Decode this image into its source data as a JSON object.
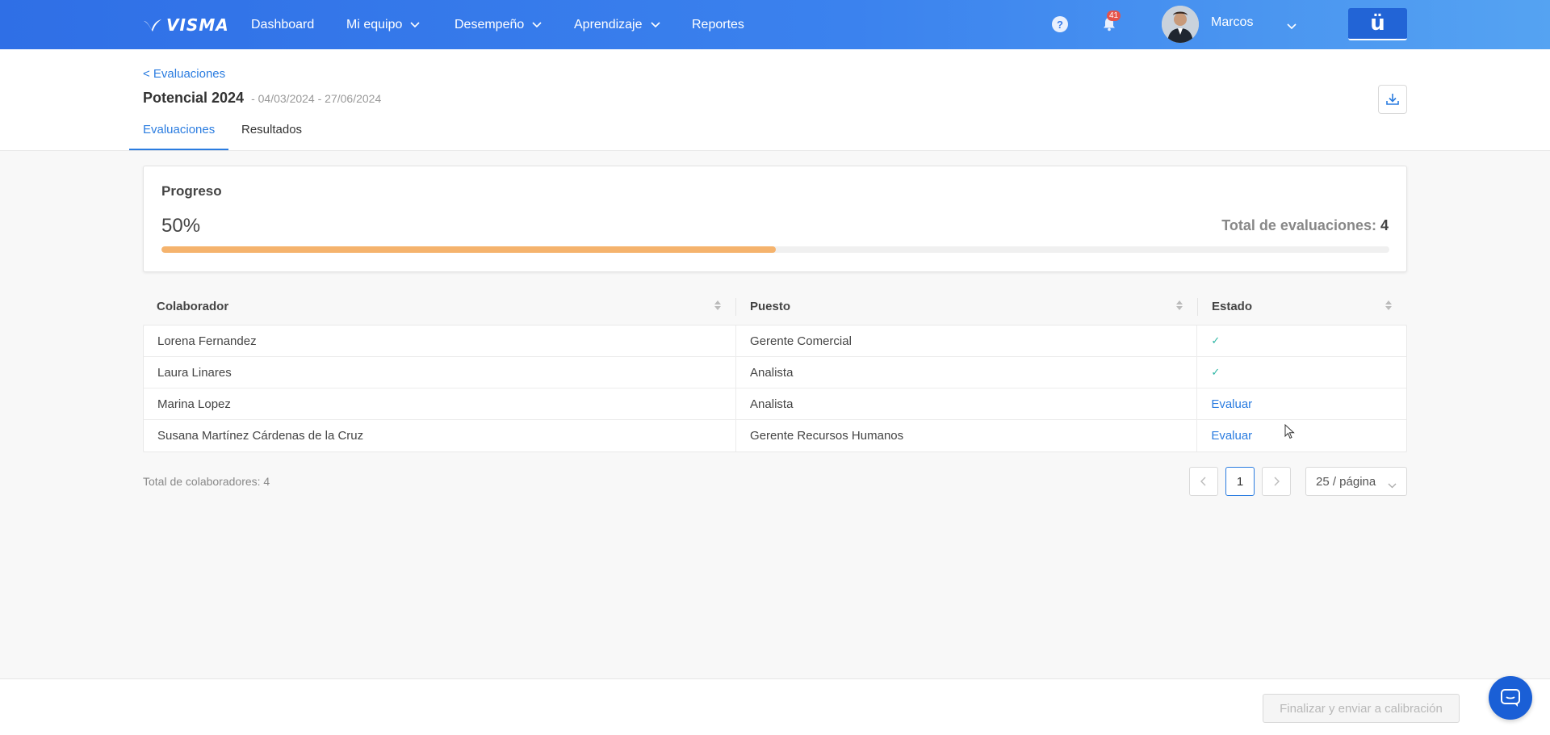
{
  "nav": {
    "brand": "VISMA",
    "items": [
      {
        "label": "Dashboard",
        "has_dropdown": false
      },
      {
        "label": "Mi equipo",
        "has_dropdown": true
      },
      {
        "label": "Desempeño",
        "has_dropdown": true
      },
      {
        "label": "Aprendizaje",
        "has_dropdown": true
      },
      {
        "label": "Reportes",
        "has_dropdown": false
      }
    ],
    "help_icon": "question-circle-icon",
    "notifications_count": "41",
    "user_name": "Marcos",
    "app_button_label": "ü"
  },
  "header": {
    "back_link": "< Evaluaciones",
    "title": "Potencial 2024",
    "dates": "- 04/03/2024 - 27/06/2024",
    "tabs": [
      {
        "label": "Evaluaciones",
        "active": true
      },
      {
        "label": "Resultados",
        "active": false
      }
    ]
  },
  "progress": {
    "title": "Progreso",
    "percent_label": "50%",
    "percent_value": 50,
    "total_label": "Total de evaluaciones:",
    "total_value": "4",
    "bar_color": "#f5b36d"
  },
  "table": {
    "columns": [
      "Colaborador",
      "Puesto",
      "Estado"
    ],
    "rows": [
      {
        "name": "Lorena Fernandez",
        "position": "Gerente Comercial",
        "status": "done"
      },
      {
        "name": "Laura Linares",
        "position": "Analista",
        "status": "done"
      },
      {
        "name": "Marina Lopez",
        "position": "Analista",
        "status": "Evaluar"
      },
      {
        "name": "Susana Martínez Cárdenas de la Cruz",
        "position": "Gerente Recursos Humanos",
        "status": "Evaluar"
      }
    ]
  },
  "footer": {
    "total_collaborators": "Total de colaboradores: 4",
    "current_page": "1",
    "per_page": "25 / página",
    "submit_label": "Finalizar y enviar a calibración"
  },
  "colors": {
    "accent": "#2a7ce0",
    "check": "#2bb5a3"
  }
}
